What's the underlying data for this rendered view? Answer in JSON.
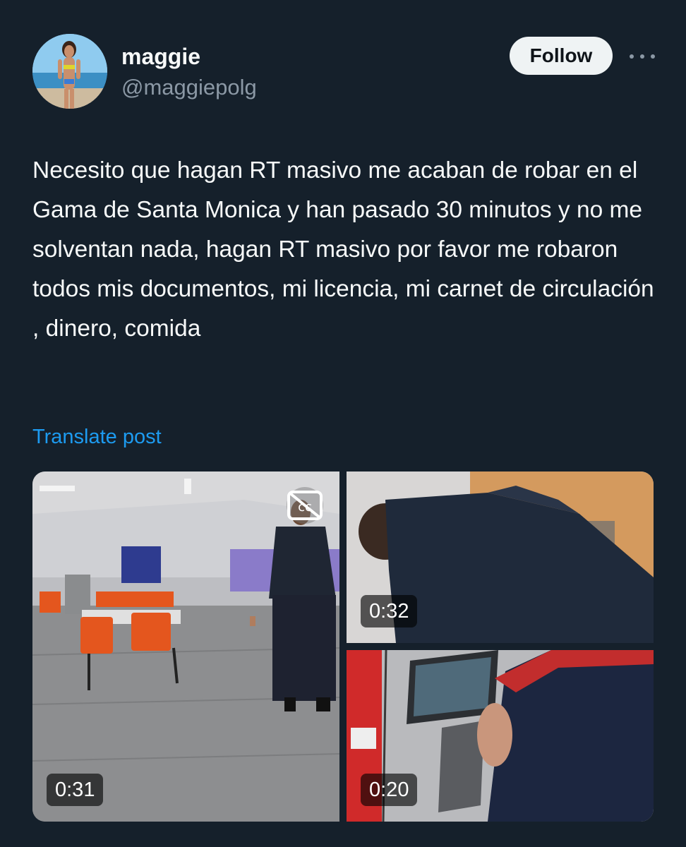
{
  "author": {
    "display_name": "maggie",
    "handle": "@maggiepolg",
    "avatar_icon": "avatar-photo"
  },
  "actions": {
    "follow_label": "Follow",
    "more_icon": "more-horizontal-icon"
  },
  "post": {
    "text": "Necesito que hagan RT masivo me acaban de robar en el Gama de Santa Monica y han pasado 30 minutos y no me solventan nada, hagan RT masivo por favor me robaron todos mis documentos, mi licencia, mi carnet de circulación , dinero, comida",
    "translate_label": "Translate post"
  },
  "media": [
    {
      "duration": "0:31",
      "type": "video"
    },
    {
      "duration": "0:32",
      "type": "video"
    },
    {
      "duration": "0:20",
      "type": "video"
    }
  ],
  "colors": {
    "background": "#15202b",
    "text_primary": "#f7f9f9",
    "text_secondary": "#8b98a5",
    "link": "#1d9bf0",
    "follow_bg": "#eff3f4"
  }
}
